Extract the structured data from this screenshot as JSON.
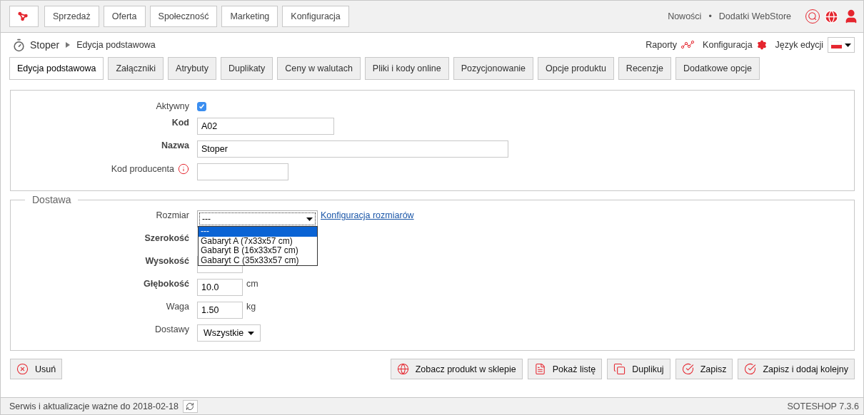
{
  "top_bar": {
    "menu": [
      {
        "label": "Sprzedaż"
      },
      {
        "label": "Oferta"
      },
      {
        "label": "Społeczność"
      },
      {
        "label": "Marketing"
      },
      {
        "label": "Konfiguracja"
      }
    ],
    "links": [
      "Nowości",
      "Dodatki WebStore"
    ],
    "separator": "•"
  },
  "breadcrumb": {
    "product": "Stoper",
    "current": "Edycja podstawowa"
  },
  "tools": [
    {
      "label": "Raporty",
      "kind": "chart"
    },
    {
      "label": "Konfiguracja",
      "kind": "gear"
    },
    {
      "label": "Język edycji",
      "kind": "language"
    }
  ],
  "tabs": [
    {
      "label": "Edycja podstawowa",
      "selected": true
    },
    {
      "label": "Załączniki",
      "selected": false
    },
    {
      "label": "Atrybuty",
      "selected": false
    },
    {
      "label": "Duplikaty",
      "selected": false
    },
    {
      "label": "Ceny w walutach",
      "selected": false
    },
    {
      "label": "Pliki i kody online",
      "selected": false
    },
    {
      "label": "Pozycjonowanie",
      "selected": false
    },
    {
      "label": "Opcje produktu",
      "selected": false
    },
    {
      "label": "Recenzje",
      "selected": false
    },
    {
      "label": "Dodatkowe opcje",
      "selected": false
    }
  ],
  "main_fields": [
    {
      "label": "Aktywny",
      "kind": "checkbox",
      "bold": false,
      "checked": true
    },
    {
      "label": "Kod",
      "kind": "text",
      "bold": true,
      "value": "A02"
    },
    {
      "label": "Nazwa",
      "kind": "text",
      "bold": true,
      "value": "Stoper"
    },
    {
      "label": "Kod producenta",
      "kind": "text",
      "bold": false,
      "info": true
    }
  ],
  "delivery": {
    "legend": "Dostawa",
    "fields": [
      {
        "label": "Rozmiar",
        "kind": "select",
        "bold": false,
        "value": "---",
        "link": "Konfiguracja rozmiarów",
        "options": [
          {
            "label": "---",
            "selected": true
          },
          {
            "label": "Gabaryt A (7x33x57 cm)",
            "selected": false
          },
          {
            "label": "Gabaryt B (16x33x57 cm)",
            "selected": false
          },
          {
            "label": "Gabaryt C (35x33x57 cm)",
            "selected": false
          }
        ]
      },
      {
        "label": "Szerokość",
        "kind": "hidden",
        "bold": true
      },
      {
        "label": "Wysokość",
        "kind": "covered",
        "bold": true
      },
      {
        "label": "Głębokość",
        "kind": "unit",
        "bold": true,
        "value": "10.0",
        "unit": "cm"
      },
      {
        "label": "Waga",
        "kind": "unit",
        "bold": false,
        "value": "1.50",
        "unit": "kg"
      },
      {
        "label": "Dostawy",
        "kind": "dropdown",
        "bold": false,
        "value": "Wszystkie"
      }
    ]
  },
  "actions_left": [
    {
      "label": "Usuń",
      "kind": "delete"
    }
  ],
  "actions_right": [
    {
      "label": "Zobacz produkt w sklepie",
      "kind": "globe"
    },
    {
      "label": "Pokaż listę",
      "kind": "list"
    },
    {
      "label": "Duplikuj",
      "kind": "copy"
    },
    {
      "label": "Zapisz",
      "kind": "check"
    },
    {
      "label": "Zapisz i dodaj kolejny",
      "kind": "check"
    }
  ],
  "status_bar": {
    "text": "Serwis i aktualizacje ważne do 2018-02-18",
    "version": "SOTESHOP 7.3.6"
  }
}
